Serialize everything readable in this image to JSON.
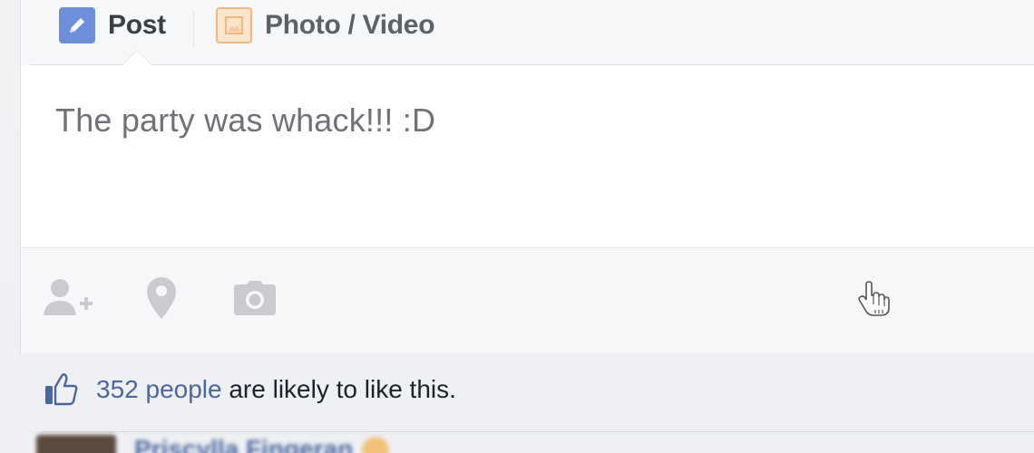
{
  "composer": {
    "tabs": [
      {
        "label": "Post",
        "icon": "pencil-icon"
      },
      {
        "label": "Photo / Video",
        "icon": "photo-icon"
      }
    ],
    "post_text": "The party was whack!!! :D",
    "toolbar": {
      "tag_icon": "tag-friends-icon",
      "location_icon": "location-pin-icon",
      "camera_icon": "camera-icon"
    }
  },
  "likes": {
    "count_link": "352 people",
    "rest_text": " are likely to like this.",
    "icon": "thumbs-up-icon"
  },
  "commenter": {
    "name": "Priscylla Fingeran"
  },
  "colors": {
    "link": "#4b67a1",
    "pencil_tab": "#6d8ed8",
    "photo_tab_border": "#f1b77c"
  }
}
